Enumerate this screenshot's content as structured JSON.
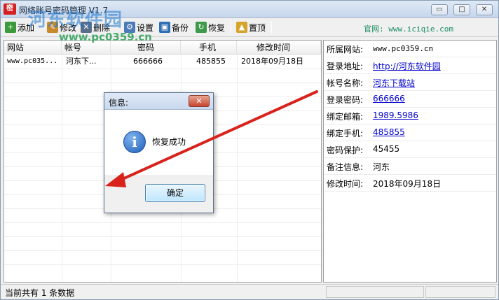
{
  "window": {
    "title": "网络账号密码管理 V1.7",
    "app_icon_text": "密",
    "watermark": "河东软件园",
    "watermark_url": "www.pc0359.cn",
    "minimize_label": "▭",
    "maximize_label": "□",
    "close_label": "✕"
  },
  "toolbar": {
    "add_label": "添加",
    "edit_label": "修改",
    "delete_label": "删除",
    "settings_label": "设置",
    "backup_label": "备份",
    "restore_label": "恢复",
    "pin_label": "置顶",
    "website": "官网: www.iciqie.com"
  },
  "table": {
    "columns": [
      "网站",
      "帐号",
      "密码",
      "手机",
      "修改时间"
    ],
    "rows": [
      [
        "www.pc035...",
        "河东下...",
        "666666",
        "485855",
        "2018年09月18日"
      ]
    ]
  },
  "detail": {
    "rows": [
      {
        "label": "所属网站:",
        "value": "www.pc0359.cn"
      },
      {
        "label": "登录地址:",
        "value": "http://河东软件园"
      },
      {
        "label": "帐号名称:",
        "value": "河东下载站"
      },
      {
        "label": "登录密码:",
        "value": "666666"
      },
      {
        "label": "绑定邮箱:",
        "value": "1989.5986"
      },
      {
        "label": "绑定手机:",
        "value": "485855"
      },
      {
        "label": "密码保护:",
        "value": "45455"
      },
      {
        "label": "备注信息:",
        "value": "河东"
      },
      {
        "label": "修改时间:",
        "value": "2018年09月18日"
      }
    ]
  },
  "status": {
    "text": "当前共有 1 条数据"
  },
  "dialog": {
    "title": "信息:",
    "close_label": "✕",
    "icon": "info-icon",
    "icon_glyph": "i",
    "message": "恢复成功",
    "ok_label": "确定"
  },
  "colors": {
    "arrow": "#d9221c",
    "website": "#1a8a62",
    "link": "#0000cc"
  }
}
